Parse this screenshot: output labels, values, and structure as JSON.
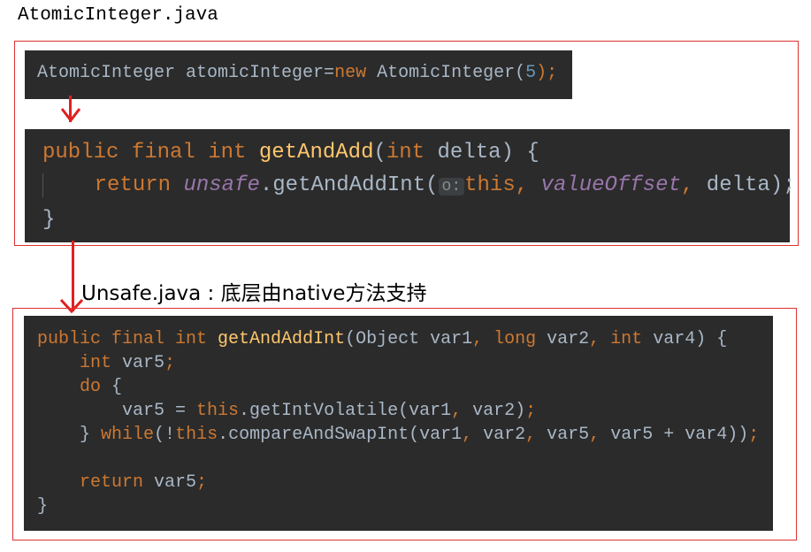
{
  "file_title": "AtomicInteger.java",
  "snippet1": {
    "type1": "AtomicInteger",
    "var": " atomicInteger=",
    "kw_new": "new",
    "type2": " AtomicInteger(",
    "num": "5",
    "close": ");"
  },
  "snippet2": {
    "l1_kw": "public final int ",
    "l1_fn": "getAndAdd",
    "l1_p1": "(",
    "l1_kw2": "int",
    "l1_rest": " delta) {",
    "l2_kw": "return ",
    "l2_it": "unsafe",
    "l2_mid": ".getAndAddInt(",
    "l2_hint": "o:",
    "l2_this": "this, ",
    "l2_it2": "valueOffset",
    "l2_comma": ", ",
    "l2_end": "delta);",
    "l3": "}"
  },
  "unsafe_title": "Unsafe.java : 底层由native方法支持",
  "snippet3": {
    "l1_kw": "public final int ",
    "l1_fn": "getAndAddInt",
    "l1_a": "(Object var1",
    "l1_c1": ", ",
    "l1_kw2": "long ",
    "l1_b": "var2",
    "l1_c2": ", ",
    "l1_kw3": "int ",
    "l1_c": "var4) {",
    "l2_kw": "int ",
    "l2_b": "var5",
    "l2_semi": ";",
    "l3_kw": "do ",
    "l3_b": "{",
    "l4_a": "var5 = ",
    "l4_kw": "this",
    "l4_b": ".getIntVolatile(var1",
    "l4_c": ", ",
    "l4_d": "var2)",
    "l4_semi": ";",
    "l5_a": "} ",
    "l5_kw": "while",
    "l5_b": "(!",
    "l5_kw2": "this",
    "l5_c": ".compareAndSwapInt(var1",
    "l5_c1": ", ",
    "l5_d": "var2",
    "l5_c2": ", ",
    "l5_e": "var5",
    "l5_c3": ", ",
    "l5_f": "var5 + var4))",
    "l5_semi": ";",
    "l7_kw": "return ",
    "l7_b": "var5",
    "l7_semi": ";",
    "l8": "}"
  },
  "colors": {
    "frame": "#e03030",
    "code_bg": "#2b2b2b",
    "keyword": "#cc7832",
    "function": "#ffc66d",
    "number": "#6897bb"
  }
}
